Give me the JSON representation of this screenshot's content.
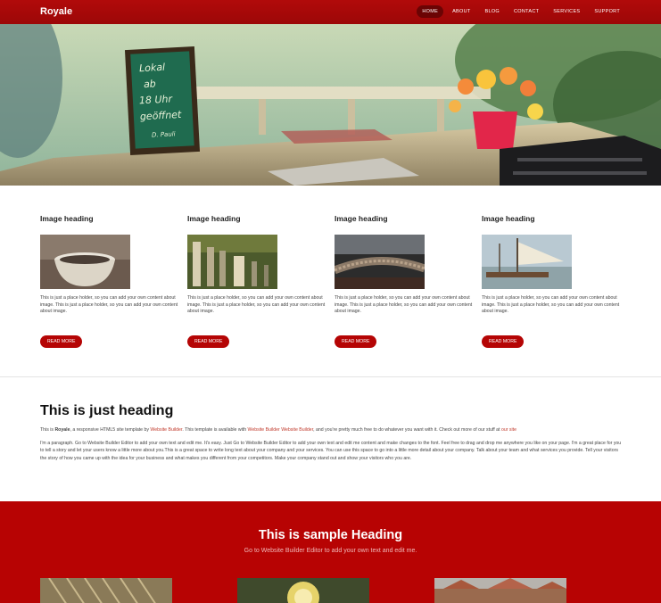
{
  "brand": "Royale",
  "nav": {
    "items": [
      {
        "label": "HOME"
      },
      {
        "label": "ABOUT"
      },
      {
        "label": "BLOG"
      },
      {
        "label": "CONTACT"
      },
      {
        "label": "SERVICES"
      },
      {
        "label": "SUPPORT"
      }
    ]
  },
  "hero": {
    "sign": [
      "Lokal",
      "ab",
      "18 Uhr",
      "geöffnet",
      "D. Pauli"
    ]
  },
  "features": [
    {
      "title": "Image heading",
      "text": "This is just a place holder, so you can add your own content about image. This is just a place holder, so you can add your own content about image.",
      "button": "READ MORE"
    },
    {
      "title": "Image heading",
      "text": "This is just a place holder, so you can add your own content about image. This is just a place holder, so you can add your own content about image.",
      "button": "READ MORE"
    },
    {
      "title": "Image heading",
      "text": "This is just a place holder, so you can add your own content about image. This is just a place holder, so you can add your own content about image.",
      "button": "READ MORE"
    },
    {
      "title": "Image heading",
      "text": "This is just a place holder, so you can add your own content about image. This is just a place holder, so you can add your own content about image.",
      "button": "READ MORE"
    }
  ],
  "text_section": {
    "heading": "This is just heading",
    "intro_prefix": "This is ",
    "intro_brand": "Royale",
    "intro_mid": ", a responsive HTML5 site template by ",
    "intro_link1": "Website Builder",
    "intro_mid2": ". This template is available with ",
    "intro_link2": "Website Builder Website Builder",
    "intro_mid3": ", and you're pretty much free to do whatever you want with it. Check out more of our stuff at ",
    "intro_link3": "our site",
    "paragraph": "I'm a paragraph. Go to Website Builder Editor to add your own text and edit me. It's easy. Just Go to Website Builder Editor to add your own text and edit me content and make changes to the font. Feel free to drag and drop me anywhere you like on your page. I'm a great place for you to tell a story and let your users know a little more about you.This is a great space to write long text about your company and your services. You can use this space to go into a little more detail about your company. Talk about your team and what services you provide. Tell your visitors the story of how you came up with the idea for your business and what makes you different from your competitors. Make your company stand out and show your visitors who you are."
  },
  "red_section": {
    "heading": "This is sample Heading",
    "subheading": "Go to Website Builder Editor to add your own text and edit me."
  },
  "colors": {
    "brand_red": "#b70303",
    "nav_active": "#6b0404",
    "link_red": "#c0392b"
  }
}
